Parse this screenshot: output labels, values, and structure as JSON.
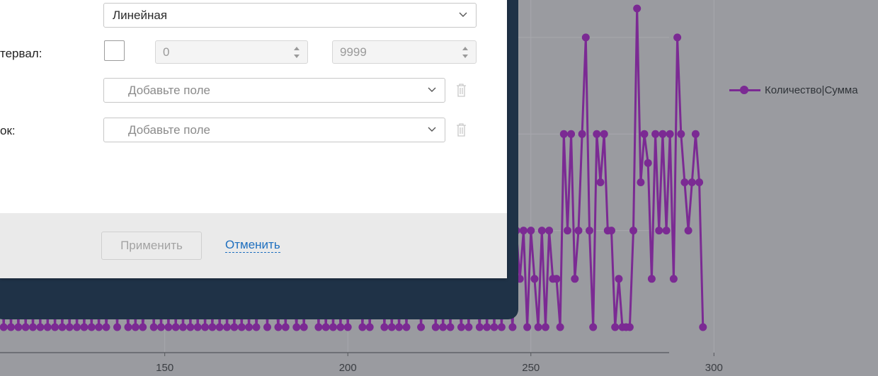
{
  "dialog": {
    "rows": [
      {
        "label": ""
      },
      {
        "label": "тервал:"
      },
      {
        "label": ""
      },
      {
        "label": "ок:"
      }
    ],
    "scale_select": {
      "value": "Линейная",
      "icon": "chevron-down-icon"
    },
    "interval": {
      "min_value": "0",
      "max_value": "9999",
      "checked": false
    },
    "field_select_1": {
      "placeholder": "Добавьте поле",
      "icon": "chevron-down-icon",
      "delete_icon": "trash-icon"
    },
    "field_select_2": {
      "placeholder": "Добавьте поле",
      "icon": "chevron-down-icon",
      "delete_icon": "trash-icon"
    },
    "footer": {
      "apply_label": "Применить",
      "cancel_label": "Отменить"
    }
  },
  "colors": {
    "backdrop": "#9a9ba0",
    "series": "#7b2a93",
    "frame": "#1f3247",
    "link": "#1e6fbf"
  },
  "chart_data": {
    "type": "line",
    "xlim": [
      105,
      310
    ],
    "ylim": [
      0,
      3.3
    ],
    "x_ticks": [
      150,
      200,
      250,
      300
    ],
    "x_tick_labels": [
      "150",
      "200",
      "250",
      "300"
    ],
    "grid": true,
    "legend_position": "right",
    "series": [
      {
        "name": "Количество|Сумма",
        "points": [
          [
            105,
            1
          ],
          [
            106,
            0
          ],
          [
            107,
            1
          ],
          [
            108,
            0
          ],
          [
            109,
            1
          ],
          [
            110,
            0
          ],
          [
            111,
            1
          ],
          [
            112,
            0
          ],
          [
            113,
            1
          ],
          [
            114,
            0
          ],
          [
            115,
            1
          ],
          [
            116,
            0
          ],
          [
            117,
            2
          ],
          [
            118,
            0
          ],
          [
            119,
            1
          ],
          [
            120,
            0
          ],
          [
            121,
            1
          ],
          [
            122,
            0
          ],
          [
            123,
            1
          ],
          [
            124,
            0
          ],
          [
            125,
            1
          ],
          [
            126,
            0
          ],
          [
            127,
            1
          ],
          [
            128,
            0
          ],
          [
            129,
            1
          ],
          [
            130,
            0
          ],
          [
            131,
            1
          ],
          [
            132,
            0
          ],
          [
            133,
            1
          ],
          [
            134,
            0
          ],
          [
            135,
            0.5
          ],
          [
            136,
            1
          ],
          [
            137,
            0
          ],
          [
            138,
            1
          ],
          [
            139,
            0.5
          ],
          [
            140,
            0
          ],
          [
            141,
            1
          ],
          [
            142,
            0
          ],
          [
            143,
            1
          ],
          [
            144,
            0
          ],
          [
            145,
            0.5
          ],
          [
            146,
            1
          ],
          [
            147,
            0
          ],
          [
            148,
            1
          ],
          [
            149,
            0
          ],
          [
            150,
            1
          ],
          [
            151,
            0
          ],
          [
            152,
            1
          ],
          [
            153,
            0
          ],
          [
            154,
            1
          ],
          [
            155,
            0
          ],
          [
            156,
            1
          ],
          [
            157,
            0
          ],
          [
            158,
            1
          ],
          [
            159,
            0
          ],
          [
            160,
            1
          ],
          [
            161,
            0
          ],
          [
            162,
            1
          ],
          [
            163,
            0
          ],
          [
            164,
            1
          ],
          [
            165,
            0
          ],
          [
            166,
            1
          ],
          [
            167,
            0
          ],
          [
            168,
            1
          ],
          [
            169,
            0
          ],
          [
            170,
            1
          ],
          [
            171,
            0
          ],
          [
            172,
            1
          ],
          [
            173,
            0
          ],
          [
            174,
            1
          ],
          [
            175,
            0
          ],
          [
            176,
            0.5
          ],
          [
            177,
            1
          ],
          [
            178,
            0
          ],
          [
            179,
            1
          ],
          [
            180,
            0.5
          ],
          [
            181,
            0
          ],
          [
            182,
            1
          ],
          [
            183,
            0
          ],
          [
            184,
            1
          ],
          [
            185,
            0.5
          ],
          [
            186,
            0
          ],
          [
            187,
            1
          ],
          [
            188,
            0
          ],
          [
            189,
            1
          ],
          [
            190,
            0.5
          ],
          [
            191,
            1
          ],
          [
            192,
            0
          ],
          [
            193,
            1
          ],
          [
            194,
            0
          ],
          [
            195,
            1
          ],
          [
            196,
            0
          ],
          [
            197,
            1
          ],
          [
            198,
            0
          ],
          [
            199,
            1
          ],
          [
            200,
            0
          ],
          [
            201,
            1
          ],
          [
            202,
            0.5
          ],
          [
            203,
            1
          ],
          [
            204,
            0
          ],
          [
            205,
            1
          ],
          [
            206,
            0
          ],
          [
            207,
            1
          ],
          [
            208,
            0.5
          ],
          [
            209,
            1
          ],
          [
            210,
            0
          ],
          [
            211,
            1
          ],
          [
            212,
            0
          ],
          [
            213,
            1
          ],
          [
            214,
            0
          ],
          [
            215,
            1
          ],
          [
            216,
            0
          ],
          [
            217,
            1
          ],
          [
            218,
            0.5
          ],
          [
            219,
            1
          ],
          [
            220,
            0
          ],
          [
            221,
            1
          ],
          [
            222,
            0.5
          ],
          [
            223,
            1
          ],
          [
            224,
            0
          ],
          [
            225,
            1
          ],
          [
            226,
            0
          ],
          [
            227,
            1
          ],
          [
            228,
            0
          ],
          [
            229,
            1
          ],
          [
            230,
            0.5
          ],
          [
            231,
            0
          ],
          [
            232,
            1
          ],
          [
            233,
            0
          ],
          [
            234,
            1
          ],
          [
            235,
            0.5
          ],
          [
            236,
            0
          ],
          [
            237,
            1
          ],
          [
            238,
            0
          ],
          [
            239,
            1
          ],
          [
            240,
            0
          ],
          [
            241,
            1
          ],
          [
            242,
            0
          ],
          [
            243,
            1
          ],
          [
            244,
            0.5
          ],
          [
            245,
            0
          ],
          [
            246,
            1
          ],
          [
            247,
            0.5
          ],
          [
            248,
            1
          ],
          [
            249,
            0
          ],
          [
            250,
            1
          ],
          [
            251,
            0.5
          ],
          [
            252,
            0
          ],
          [
            253,
            1
          ],
          [
            254,
            0
          ],
          [
            255,
            1
          ],
          [
            256,
            0.5
          ],
          [
            257,
            0.5
          ],
          [
            258,
            0
          ],
          [
            259,
            2
          ],
          [
            260,
            1
          ],
          [
            261,
            2
          ],
          [
            262,
            0.5
          ],
          [
            263,
            1
          ],
          [
            264,
            2
          ],
          [
            265,
            3
          ],
          [
            266,
            1
          ],
          [
            267,
            0
          ],
          [
            268,
            2
          ],
          [
            269,
            1.5
          ],
          [
            270,
            2
          ],
          [
            271,
            1
          ],
          [
            272,
            1
          ],
          [
            273,
            0
          ],
          [
            274,
            0.5
          ],
          [
            275,
            0
          ],
          [
            276,
            0
          ],
          [
            277,
            0
          ],
          [
            278,
            1
          ],
          [
            279,
            3.3
          ],
          [
            280,
            1.5
          ],
          [
            281,
            2
          ],
          [
            282,
            1.7
          ],
          [
            283,
            0.5
          ],
          [
            284,
            2
          ],
          [
            285,
            1
          ],
          [
            286,
            2
          ],
          [
            287,
            1
          ],
          [
            288,
            2
          ],
          [
            289,
            0.5
          ],
          [
            290,
            3
          ],
          [
            291,
            2
          ],
          [
            292,
            1.5
          ],
          [
            293,
            1
          ],
          [
            294,
            1.5
          ],
          [
            295,
            2
          ],
          [
            296,
            1.5
          ],
          [
            297,
            0
          ]
        ]
      }
    ]
  }
}
